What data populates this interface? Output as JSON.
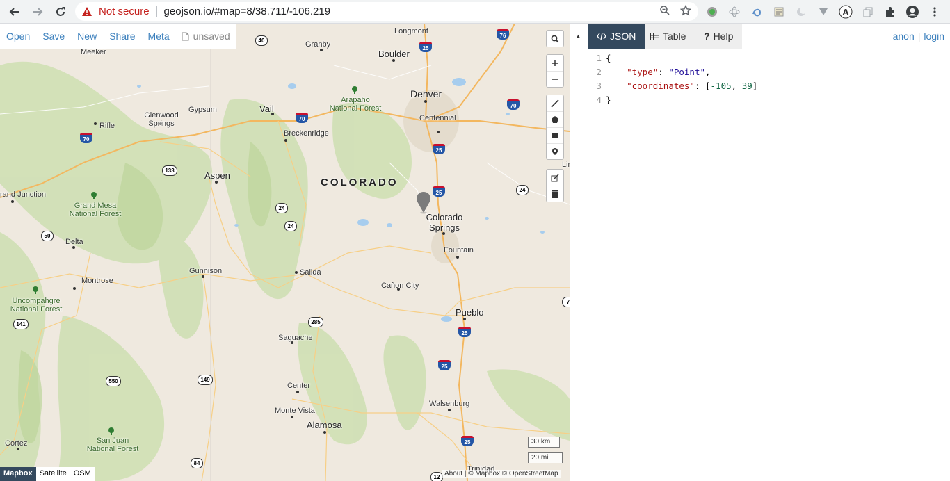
{
  "browser": {
    "security_label": "Not secure",
    "url": "geojson.io/#map=8/38.711/-106.219"
  },
  "map_menu": {
    "items": [
      "Open",
      "Save",
      "New",
      "Share",
      "Meta"
    ],
    "status": "unsaved"
  },
  "map": {
    "state_label": "COLORADO",
    "places": [
      {
        "name": "Longmont"
      },
      {
        "name": "Granby"
      },
      {
        "name": "Boulder"
      },
      {
        "name": "Meeker"
      },
      {
        "name": "Denver"
      },
      {
        "name": "Centennial"
      },
      {
        "name": "Glenwood Springs"
      },
      {
        "name": "Gypsum"
      },
      {
        "name": "Vail"
      },
      {
        "name": "Rifle"
      },
      {
        "name": "Breckenridge"
      },
      {
        "name": "Aspen"
      },
      {
        "name": "rand Junction"
      },
      {
        "name": "Colorado Springs"
      },
      {
        "name": "Fountain"
      },
      {
        "name": "Delta"
      },
      {
        "name": "Gunnison"
      },
      {
        "name": "Salida"
      },
      {
        "name": "Montrose"
      },
      {
        "name": "Cañon City"
      },
      {
        "name": "Pueblo"
      },
      {
        "name": "Saguache"
      },
      {
        "name": "Center"
      },
      {
        "name": "Walsenburg"
      },
      {
        "name": "Monte Vista"
      },
      {
        "name": "Alamosa"
      },
      {
        "name": "Cortez"
      },
      {
        "name": "Trinidad"
      }
    ],
    "forests": [
      {
        "name": "Arapaho National Forest"
      },
      {
        "name": "Grand Mesa National Forest"
      },
      {
        "name": "Uncompahgre National Forest"
      },
      {
        "name": "San Juan National Forest"
      }
    ],
    "shields": [
      "40",
      "76",
      "25",
      "70",
      "70",
      "70",
      "133",
      "25",
      "24",
      "24",
      "25",
      "24",
      "50",
      "285",
      "141",
      "550",
      "149",
      "25",
      "25",
      "25",
      "84",
      "12",
      "7"
    ],
    "scale_km": "30 km",
    "scale_mi": "20 mi",
    "layers": [
      "Mapbox",
      "Satellite",
      "OSM"
    ],
    "attribution": "About | © Mapbox © OpenStreetMap",
    "extra_label": "Lir"
  },
  "panel": {
    "tabs": [
      "JSON",
      "Table",
      "Help"
    ],
    "user": {
      "anon": "anon",
      "login": "login"
    },
    "editor_lines": [
      {
        "n": "1",
        "text": "{"
      },
      {
        "n": "2",
        "key": "\"type\"",
        "sep": ": ",
        "str": "\"Point\"",
        "end": ","
      },
      {
        "n": "3",
        "key": "\"coordinates\"",
        "sep": ": [",
        "num1": "-105",
        "comma": ", ",
        "num2": "39",
        "end": "]"
      },
      {
        "n": "4",
        "text": "}"
      }
    ]
  }
}
